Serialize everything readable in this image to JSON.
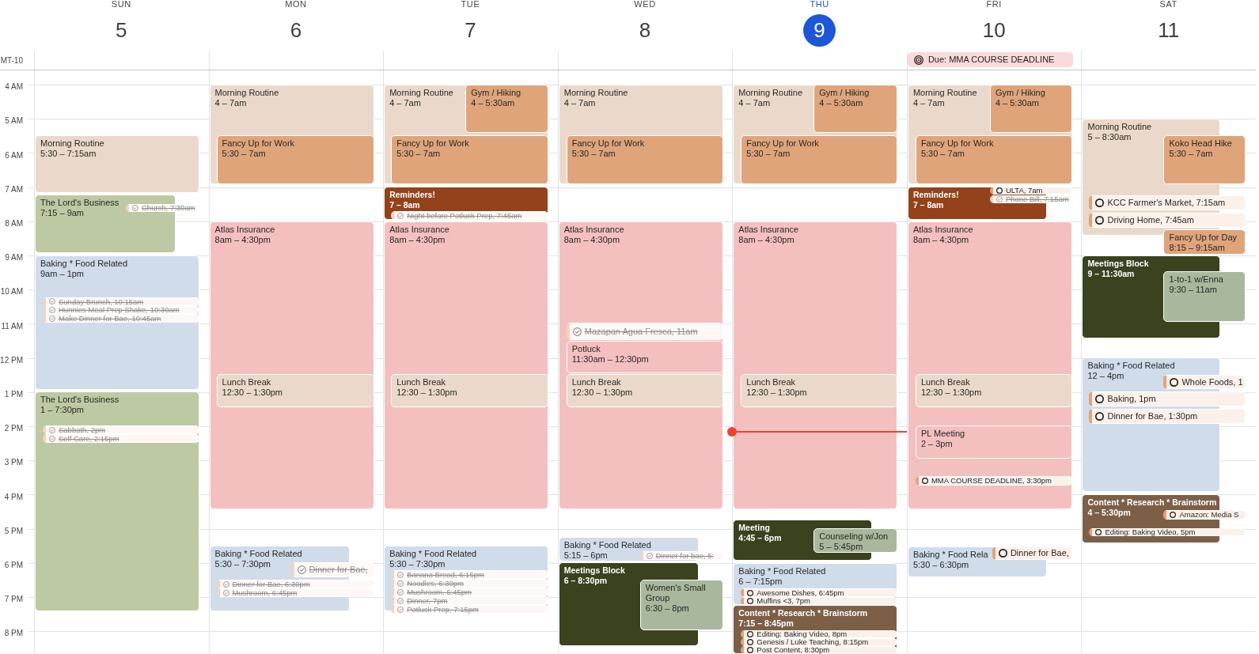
{
  "timezone": "MT-10",
  "time_labels": [
    "4 AM",
    "5 AM",
    "6 AM",
    "7 AM",
    "8 AM",
    "9 AM",
    "10 AM",
    "11 AM",
    "12 PM",
    "1 PM",
    "2 PM",
    "3 PM",
    "4 PM",
    "5 PM",
    "6 PM",
    "7 PM",
    "8 PM"
  ],
  "days": [
    {
      "name": "SUN",
      "date": "5",
      "today": false,
      "items": [
        {
          "kind": "event",
          "title": "Morning Routine",
          "time": "5:30 – 7:15am",
          "color": "#ead9ca"
        },
        {
          "kind": "event",
          "title": "The Lord's Business",
          "time": "7:15 – 9am",
          "color": "#bdc9a2"
        },
        {
          "kind": "task",
          "text": "Church, 7:30am",
          "done": true
        },
        {
          "kind": "event",
          "title": "Baking * Food Related",
          "time": "9am – 1pm",
          "color": "#d0dce9"
        },
        {
          "kind": "task",
          "text": "Sunday Brunch, 10:15am",
          "done": true
        },
        {
          "kind": "task",
          "text": "Hunnies Meal Prep Shake, 10:30am",
          "done": true
        },
        {
          "kind": "task",
          "text": "Make Dinner for Bae, 10:45am",
          "done": true
        },
        {
          "kind": "event",
          "title": "The Lord's Business",
          "time": "1 – 7:30pm",
          "color": "#bdc9a2"
        },
        {
          "kind": "task",
          "text": "Sabbath, 2pm",
          "done": true
        },
        {
          "kind": "task",
          "text": "Self Care, 2:15pm",
          "done": true
        }
      ]
    },
    {
      "name": "MON",
      "date": "6",
      "today": false,
      "items": [
        {
          "kind": "event",
          "title": "Morning Routine",
          "time": "4 – 7am",
          "color": "#ead9ca"
        },
        {
          "kind": "event",
          "title": "Fancy Up for Work",
          "time": "5:30 – 7am",
          "color": "#dfa47a"
        },
        {
          "kind": "event",
          "title": "Atlas Insurance",
          "time": "8am – 4:30pm",
          "color": "#f4bfbf"
        },
        {
          "kind": "event",
          "title": "Lunch Break",
          "time": "12:30 – 1:30pm",
          "color": "#ead9ca"
        },
        {
          "kind": "event",
          "title": "Baking * Food Related",
          "time": "5:30 – 7:30pm",
          "color": "#d0dce9"
        },
        {
          "kind": "task",
          "text": "Dinner for Bae,",
          "done": true
        },
        {
          "kind": "task",
          "text": "Dinner for Bae, 6:30pm",
          "done": true
        },
        {
          "kind": "task",
          "text": "Mushroom, 6:45pm",
          "done": true
        }
      ]
    },
    {
      "name": "TUE",
      "date": "7",
      "today": false,
      "items": [
        {
          "kind": "event",
          "title": "Morning Routine",
          "time": "4 – 7am",
          "color": "#ead9ca"
        },
        {
          "kind": "event",
          "title": "Gym / Hiking",
          "time": "4 – 5:30am",
          "color": "#dfa47a"
        },
        {
          "kind": "event",
          "title": "Fancy Up for Work",
          "time": "5:30 – 7am",
          "color": "#dfa47a"
        },
        {
          "kind": "event",
          "title": "Reminders!",
          "time": "7 – 8am",
          "color": "#93421b"
        },
        {
          "kind": "task",
          "text": "Night before Potluck Prep, 7:45am",
          "done": true
        },
        {
          "kind": "event",
          "title": "Atlas Insurance",
          "time": "8am – 4:30pm",
          "color": "#f4bfbf"
        },
        {
          "kind": "event",
          "title": "Lunch Break",
          "time": "12:30 – 1:30pm",
          "color": "#ead9ca"
        },
        {
          "kind": "event",
          "title": "Baking * Food Related",
          "time": "5:30 – 7:30pm",
          "color": "#d0dce9"
        },
        {
          "kind": "task",
          "text": "Banana Bread, 6:15pm",
          "done": true
        },
        {
          "kind": "task",
          "text": "Noodles, 6:30pm",
          "done": true
        },
        {
          "kind": "task",
          "text": "Mushroom, 6:45pm",
          "done": true
        },
        {
          "kind": "task",
          "text": "Dinner, 7pm",
          "done": true
        },
        {
          "kind": "task",
          "text": "Potluck Prep, 7:15pm",
          "done": true
        }
      ]
    },
    {
      "name": "WED",
      "date": "8",
      "today": false,
      "items": [
        {
          "kind": "event",
          "title": "Morning Routine",
          "time": "4 – 7am",
          "color": "#ead9ca"
        },
        {
          "kind": "event",
          "title": "Fancy Up for Work",
          "time": "5:30 – 7am",
          "color": "#dfa47a"
        },
        {
          "kind": "event",
          "title": "Atlas Insurance",
          "time": "8am – 4:30pm",
          "color": "#f4bfbf"
        },
        {
          "kind": "task",
          "text": "Mazapan Agua Fresca, 11am",
          "done": true
        },
        {
          "kind": "event",
          "title": "Potluck",
          "time": "11:30am – 12:30pm",
          "color": "#f4bfbf"
        },
        {
          "kind": "event",
          "title": "Lunch Break",
          "time": "12:30 – 1:30pm",
          "color": "#ead9ca"
        },
        {
          "kind": "event",
          "title": "Baking * Food Related",
          "time": "5:15 – 6pm",
          "color": "#d0dce9"
        },
        {
          "kind": "task",
          "text": "Dinner for bae, 5:",
          "done": true
        },
        {
          "kind": "event",
          "title": "Meetings Block",
          "time": "6 – 8:30pm",
          "color": "#3a421e"
        },
        {
          "kind": "event",
          "title": "Women's Small Group",
          "time": "6:30 – 8pm",
          "color": "#a9b89d"
        }
      ]
    },
    {
      "name": "THU",
      "date": "9",
      "today": true,
      "items": [
        {
          "kind": "event",
          "title": "Morning Routine",
          "time": "4 – 7am",
          "color": "#ead9ca"
        },
        {
          "kind": "event",
          "title": "Gym / Hiking",
          "time": "4 – 5:30am",
          "color": "#dfa47a"
        },
        {
          "kind": "event",
          "title": "Fancy Up for Work",
          "time": "5:30 – 7am",
          "color": "#dfa47a"
        },
        {
          "kind": "event",
          "title": "Atlas Insurance",
          "time": "8am – 4:30pm",
          "color": "#f4bfbf"
        },
        {
          "kind": "event",
          "title": "Lunch Break",
          "time": "12:30 – 1:30pm",
          "color": "#ead9ca"
        },
        {
          "kind": "event",
          "title": "Meeting",
          "time": "4:45 – 6pm",
          "color": "#3a421e"
        },
        {
          "kind": "event",
          "title": "Counseling w/Jon",
          "time": "5 – 5:45pm",
          "color": "#a9b89d"
        },
        {
          "kind": "event",
          "title": "Baking * Food Related",
          "time": "6 – 7:15pm",
          "color": "#d0dce9"
        },
        {
          "kind": "task",
          "text": "Awesome Dishes, 6:45pm",
          "done": false
        },
        {
          "kind": "task",
          "text": "Muffins <3, 7pm",
          "done": false
        },
        {
          "kind": "event",
          "title": "Content * Research * Brainstorm",
          "time": "7:15 – 8:45pm",
          "color": "#7d5f47"
        },
        {
          "kind": "task",
          "text": "Editing: Baking Video, 8pm",
          "done": false
        },
        {
          "kind": "task",
          "text": "Genesis / Luke Teaching, 8:15pm",
          "done": false
        },
        {
          "kind": "task",
          "text": "Post Content, 8:30pm",
          "done": false
        }
      ]
    },
    {
      "name": "FRI",
      "date": "10",
      "today": false,
      "all_day": [
        {
          "text": "Due: MMA COURSE DEADLINE"
        }
      ],
      "items": [
        {
          "kind": "event",
          "title": "Morning Routine",
          "time": "4 – 7am",
          "color": "#ead9ca"
        },
        {
          "kind": "event",
          "title": "Gym / Hiking",
          "time": "4 – 5:30am",
          "color": "#dfa47a"
        },
        {
          "kind": "event",
          "title": "Fancy Up for Work",
          "time": "5:30 – 7am",
          "color": "#dfa47a"
        },
        {
          "kind": "event",
          "title": "Reminders!",
          "time": "7 – 8am",
          "color": "#93421b"
        },
        {
          "kind": "task",
          "text": "ULTA, 7am",
          "done": false
        },
        {
          "kind": "task",
          "text": "Phone Bill, 7:15am",
          "done": true
        },
        {
          "kind": "event",
          "title": "Atlas Insurance",
          "time": "8am – 4:30pm",
          "color": "#f4bfbf"
        },
        {
          "kind": "event",
          "title": "Lunch Break",
          "time": "12:30 – 1:30pm",
          "color": "#ead9ca"
        },
        {
          "kind": "event",
          "title": "PL Meeting",
          "time": "2 – 3pm",
          "color": "#f4bfbf"
        },
        {
          "kind": "task",
          "text": "MMA COURSE DEADLINE, 3:30pm",
          "done": false
        },
        {
          "kind": "event",
          "title": "Baking * Food Rela",
          "time": "5:30 – 6:30pm",
          "color": "#d0dce9"
        },
        {
          "kind": "task",
          "text": "Dinner for Bae,",
          "done": false
        }
      ]
    },
    {
      "name": "SAT",
      "date": "11",
      "today": false,
      "items": [
        {
          "kind": "event",
          "title": "Morning Routine",
          "time": "5 – 8:30am",
          "color": "#ead9ca"
        },
        {
          "kind": "event",
          "title": "Koko Head Hike",
          "time": "5:30 – 7am",
          "color": "#dfa47a"
        },
        {
          "kind": "task",
          "text": "KCC Farmer's Market, 7:15am",
          "done": false
        },
        {
          "kind": "task",
          "text": "Driving Home, 7:45am",
          "done": false
        },
        {
          "kind": "event",
          "title": "Fancy Up for Day",
          "time": "8:15 – 9:15am",
          "color": "#dfa47a"
        },
        {
          "kind": "event",
          "title": "Meetings Block",
          "time": "9 – 11:30am",
          "color": "#3a421e"
        },
        {
          "kind": "event",
          "title": "1-to-1 w/Enna",
          "time": "9:30 – 11am",
          "color": "#a9b89d"
        },
        {
          "kind": "event",
          "title": "Baking * Food Related",
          "time": "12 – 4pm",
          "color": "#d0dce9"
        },
        {
          "kind": "task",
          "text": "Whole Foods, 1",
          "done": false
        },
        {
          "kind": "task",
          "text": "Baking, 1pm",
          "done": false
        },
        {
          "kind": "task",
          "text": "Dinner for Bae, 1:30pm",
          "done": false
        },
        {
          "kind": "event",
          "title": "Content * Research * Brainstorm",
          "time": "4 – 5:30pm",
          "color": "#7d5f47"
        },
        {
          "kind": "task",
          "text": "Amazon: Media S",
          "done": false
        },
        {
          "kind": "task",
          "text": "Editing: Baking Video, 5pm",
          "done": false
        }
      ]
    }
  ]
}
